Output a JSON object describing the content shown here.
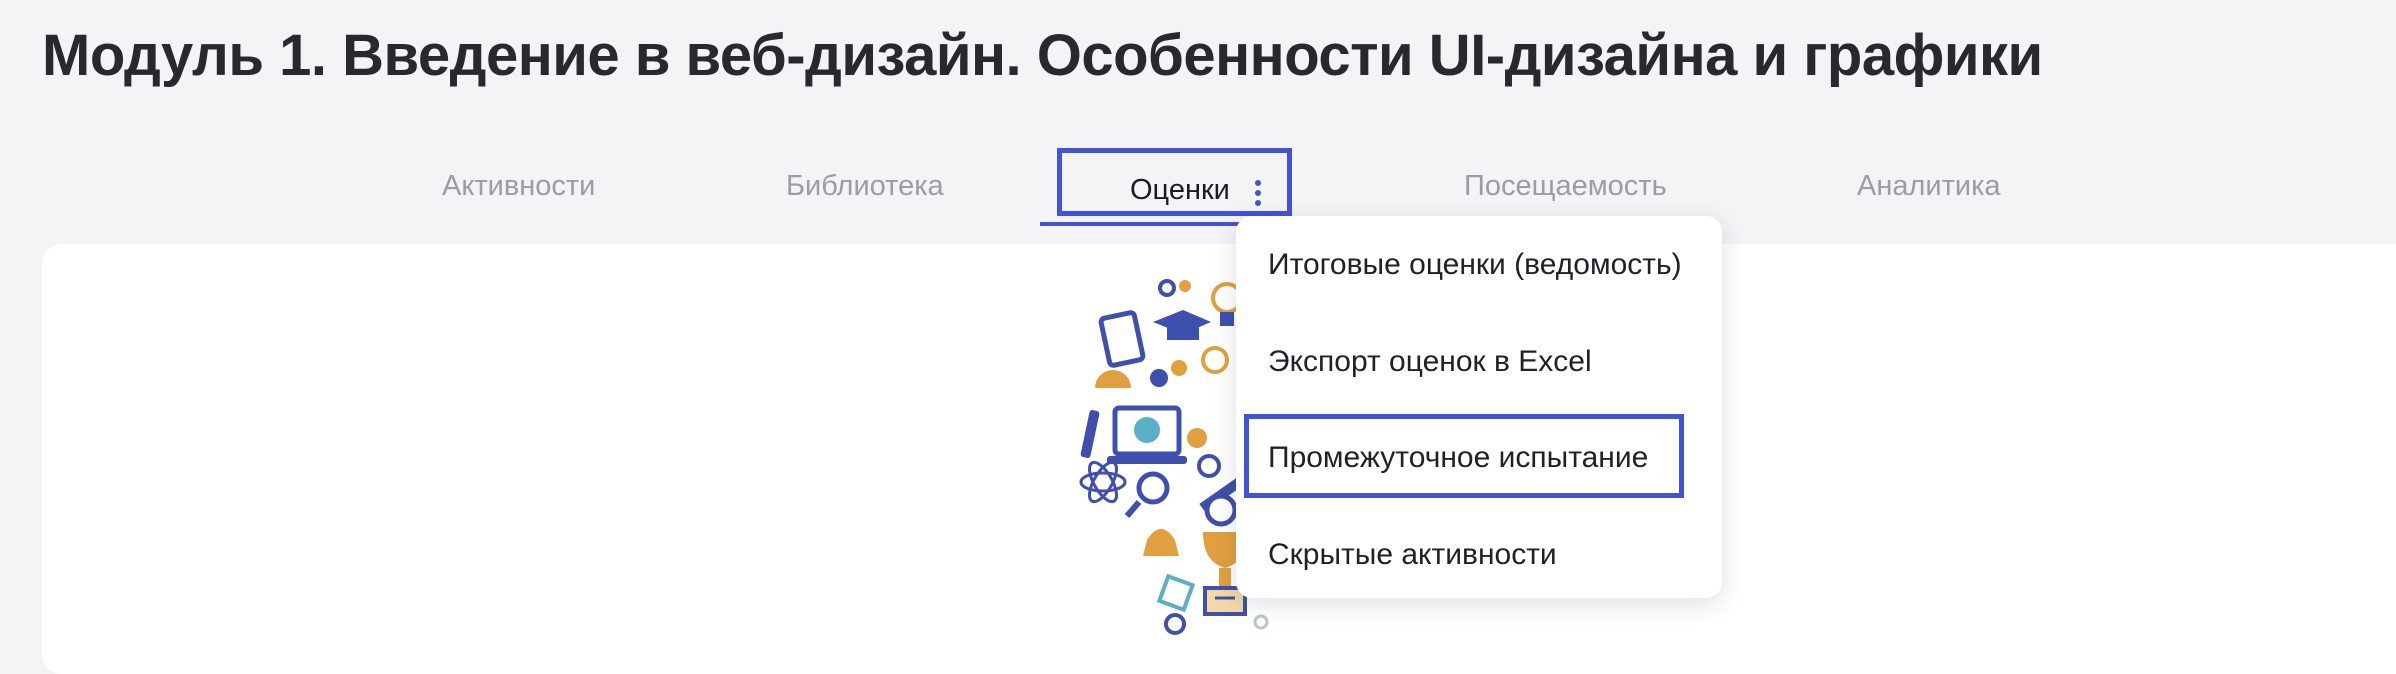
{
  "page": {
    "title": "Модуль 1. Введение в веб-дизайн. Особенности UI-дизайна и графики"
  },
  "tabs": [
    {
      "label": "Активности"
    },
    {
      "label": "Библиотека"
    },
    {
      "label": "Оценки",
      "active": true,
      "menu_icon": "kebab-menu-icon"
    },
    {
      "label": "Посещаемость"
    },
    {
      "label": "Аналитика"
    }
  ],
  "dropdown": {
    "items": [
      {
        "label": "Итоговые оценки (ведомость)"
      },
      {
        "label": "Экспорт оценок в Excel"
      },
      {
        "label": "Промежуточное испытание",
        "highlighted": true
      },
      {
        "label": "Скрытые активности"
      }
    ]
  },
  "colors": {
    "accent": "#4353d6",
    "tab_inactive": "#9a9ca6",
    "background": "#f3f4f6"
  },
  "illustration": {
    "name": "education-illustration"
  }
}
